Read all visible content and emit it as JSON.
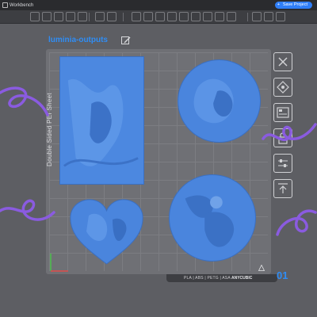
{
  "titlebar": {
    "title": "Workbench",
    "save_label": "Save Project",
    "save_icon": "+"
  },
  "project": {
    "name": "luminia-outputs"
  },
  "plate": {
    "label": "Double Sided PEI Sheet",
    "footer": "PLA | ABS | PETG | ASA",
    "brand": "ANYCUBIC",
    "number": "01"
  },
  "colors": {
    "accent": "#2f8df5",
    "model": "#4a85dd",
    "plate": "#6f7075",
    "background": "#5d5e63",
    "decoration": "#8a5be0"
  },
  "toolbar": {
    "icons": [
      "cube-icon",
      "grid-icon",
      "layers-icon",
      "box-icon",
      "folder-icon",
      "move-icon",
      "rotate-icon",
      "scale-icon",
      "mirror-icon",
      "cut-icon",
      "support-icon",
      "hollow-icon",
      "text-icon",
      "drill-icon",
      "measure-icon"
    ]
  },
  "sidebar": {
    "icons": [
      "close-icon",
      "slice-icon",
      "gallery-icon",
      "lock-icon",
      "adjust-icon",
      "upload-icon"
    ]
  }
}
